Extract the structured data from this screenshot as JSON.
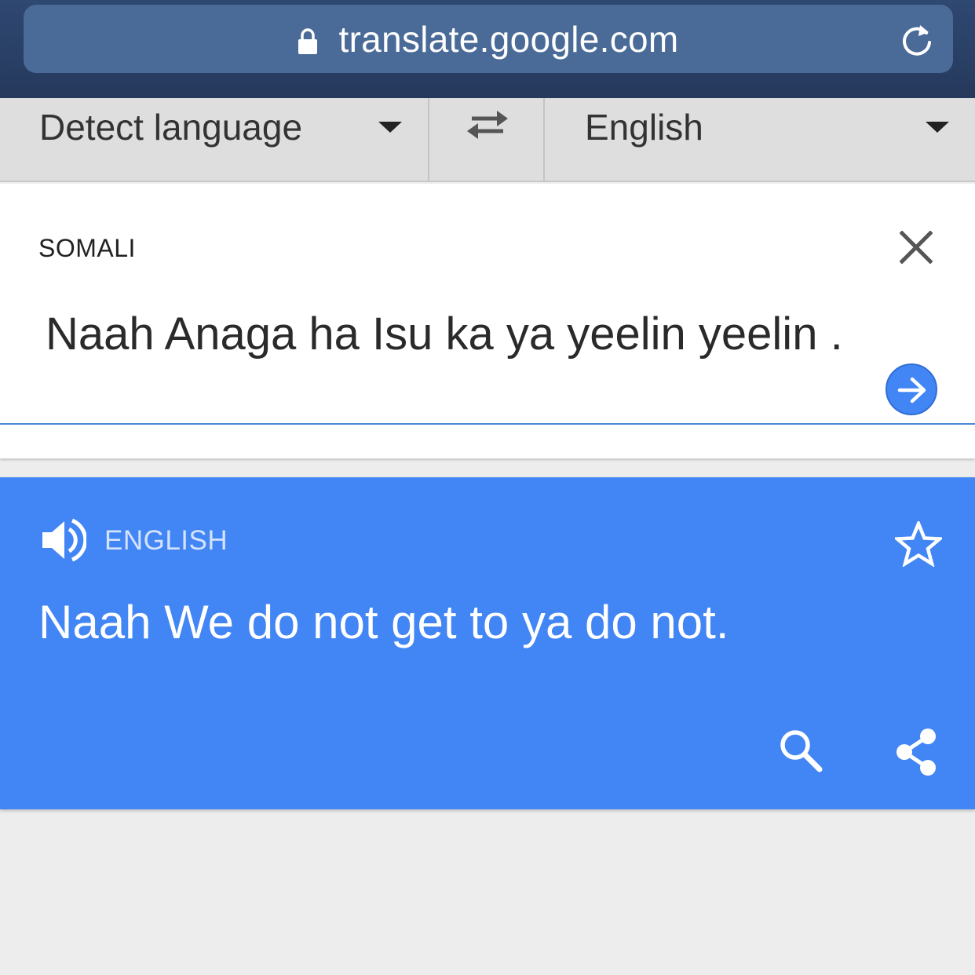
{
  "browser": {
    "url": "translate.google.com"
  },
  "language_bar": {
    "source_language": "Detect language",
    "target_language": "English"
  },
  "source": {
    "detected_language": "SOMALI",
    "text": "Naah Anaga ha Isu ka ya yeelin yeelin ."
  },
  "result": {
    "language": "ENGLISH",
    "text": "Naah We do not get to ya do not."
  },
  "colors": {
    "accent_blue": "#4285f4",
    "browser_bar": "#2f4872"
  },
  "icons": {
    "lock": "lock-icon",
    "reload": "reload-icon",
    "swap": "swap-icon",
    "clear": "close-icon",
    "go": "arrow-right-icon",
    "speaker": "speaker-icon",
    "star": "star-icon",
    "search": "search-icon",
    "share": "share-icon"
  }
}
